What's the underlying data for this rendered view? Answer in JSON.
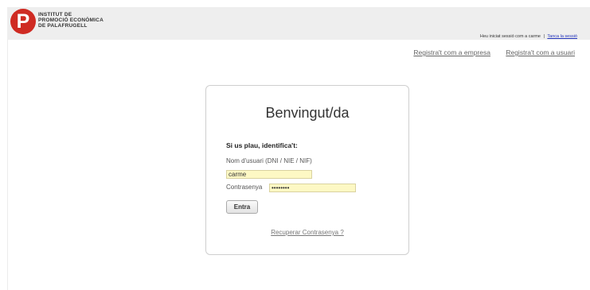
{
  "header": {
    "logo_letter": "P",
    "logo_lines": [
      "INSTITUT DE",
      "PROMOCIÓ ECONÒMICA",
      "DE PALAFRUGELL"
    ],
    "session_text": "Heu iniciat sessió com a carme",
    "separator": "|",
    "logout_label": "Tanca la sessió",
    "brand_color": "#cf2b23"
  },
  "nav": {
    "register_company": "Registra't com a empresa",
    "register_user": "Registra't com a usuari"
  },
  "login": {
    "title": "Benvingut/da",
    "subtitle": "Si us plau, identifica't:",
    "username_label": "Nom d'usuari (DNI / NIE / NIF)",
    "username_value": "carme",
    "password_label": "Contrasenya",
    "password_value": "••••••••",
    "submit_label": "Entra",
    "recover_label": "Recuperar Contrasenya ?",
    "field_highlight_color": "#fdf8c4"
  }
}
